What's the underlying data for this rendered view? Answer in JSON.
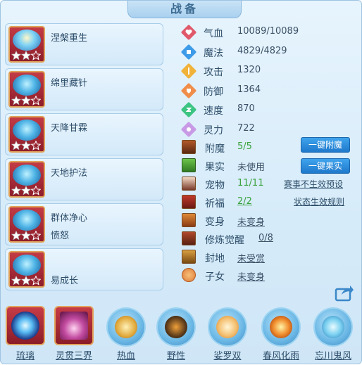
{
  "title": "战备",
  "skills": [
    {
      "name": "涅槃重生",
      "sub": "",
      "stars": 2
    },
    {
      "name": "绵里藏针",
      "sub": "",
      "stars": 2
    },
    {
      "name": "天降甘霖",
      "sub": "",
      "stars": 2
    },
    {
      "name": "天地护法",
      "sub": "",
      "stars": 2
    },
    {
      "name": "群体净心",
      "sub": "愤怒",
      "stars": 2
    },
    {
      "name": "",
      "sub": "易成长",
      "stars": 2
    }
  ],
  "stats": [
    {
      "label": "气血",
      "value": "10089/10089",
      "icon": "heart-icon",
      "color": "#e0596b"
    },
    {
      "label": "魔法",
      "value": "4829/4829",
      "icon": "mana-icon",
      "color": "#3d9be8"
    },
    {
      "label": "攻击",
      "value": "1320",
      "icon": "attack-icon",
      "color": "#f0b238"
    },
    {
      "label": "防御",
      "value": "1364",
      "icon": "shield-icon",
      "color": "#f08d4a"
    },
    {
      "label": "速度",
      "value": "870",
      "icon": "speed-icon",
      "color": "#3cc482"
    },
    {
      "label": "灵力",
      "value": "722",
      "icon": "spirit-icon",
      "color": "#c89ae6"
    }
  ],
  "misc": [
    {
      "label": "附魔",
      "value": "5/5",
      "green": true,
      "underline": false
    },
    {
      "label": "果实",
      "value": "未使用",
      "green": false,
      "underline": false
    },
    {
      "label": "宠物",
      "value": "11/11",
      "green": true,
      "underline": false
    },
    {
      "label": "祈福",
      "value": "2/2",
      "green": true,
      "underline": true
    },
    {
      "label": "变身",
      "value": "未变身",
      "green": false,
      "underline": true
    },
    {
      "label": "修炼觉醒",
      "value": "0/8",
      "green": false,
      "underline": true
    },
    {
      "label": "封地",
      "value": "未受赏",
      "green": false,
      "underline": true
    },
    {
      "label": "子女",
      "value": "未变身",
      "green": false,
      "underline": true
    }
  ],
  "buttons": {
    "one_click_enchant": "一键附魔",
    "one_click_fruit": "一键果实"
  },
  "links": {
    "match_preset": "赛事不生效预设",
    "status_rules": "状态生效规则"
  },
  "bottom_items": [
    {
      "label": "琉璃",
      "frame": "square"
    },
    {
      "label": "灵贯三界",
      "frame": "square"
    },
    {
      "label": "热血",
      "frame": "circle"
    },
    {
      "label": "野性",
      "frame": "circle"
    },
    {
      "label": "娑罗双",
      "frame": "circle"
    },
    {
      "label": "春风化雨",
      "frame": "circle"
    },
    {
      "label": "忘川鬼风",
      "frame": "circle"
    }
  ],
  "colors": {
    "accent": "#2a8ee0",
    "value_green": "#3aa23c"
  }
}
